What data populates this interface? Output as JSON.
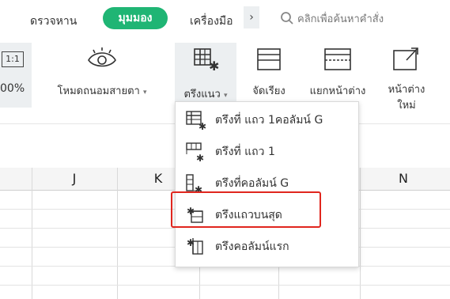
{
  "tabs": {
    "review": "ดรวจหาน",
    "view": "มุมมอง",
    "tools": "เครื่องมือ",
    "more_arrow": "›"
  },
  "search": {
    "placeholder": "คลิกเพื่อค้นหาคำสั่ง"
  },
  "ribbon": {
    "zoom_icon_text": "1:1",
    "zoom_value": "00%",
    "reading_mode": "โหมดถนอมสายตา",
    "freeze": "ตรึงแนว",
    "arrange": "จัดเรียง",
    "split": "แยกหน้าต่าง",
    "new_window_line1": "หน้าต่าง",
    "new_window_line2": "ใหม่"
  },
  "sheet": {
    "columns": [
      "J",
      "K",
      "N"
    ]
  },
  "freeze_menu": {
    "items": [
      "ตรึงที่ แถว 1คอลัมน์ G",
      "ตรึงที่ แถว 1",
      "ตรึงที่คอลัมน์ G",
      "ตรึงแถวบนสุด",
      "ตรึงคอลัมน์แรก"
    ]
  },
  "colors": {
    "accent": "#1fb574",
    "highlight": "#e0261e"
  }
}
